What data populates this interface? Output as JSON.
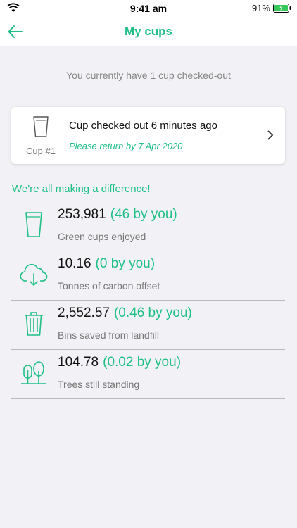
{
  "status_bar": {
    "time": "9:41 am",
    "battery": "91%"
  },
  "nav": {
    "title": "My cups"
  },
  "checkout_message": "You currently have 1 cup checked-out",
  "cup_card": {
    "title": "Cup checked out 6 minutes ago",
    "return_by": "Please return by 7 Apr 2020",
    "cup_number": "Cup #1"
  },
  "difference_heading": "We're all making a difference!",
  "stats": [
    {
      "icon": "cup-icon",
      "value": "253,981",
      "by_you": "(46 by you)",
      "label": "Green cups enjoyed"
    },
    {
      "icon": "cloud-download-icon",
      "value": "10.16",
      "by_you": "(0 by you)",
      "label": "Tonnes of carbon offset"
    },
    {
      "icon": "trash-bin-icon",
      "value": "2,552.57",
      "by_you": "(0.46 by you)",
      "label": "Bins saved from landfill"
    },
    {
      "icon": "trees-icon",
      "value": "104.78",
      "by_you": "(0.02 by you)",
      "label": "Trees still standing"
    }
  ],
  "colors": {
    "accent": "#1fbf86",
    "background": "#f2f2f6"
  }
}
